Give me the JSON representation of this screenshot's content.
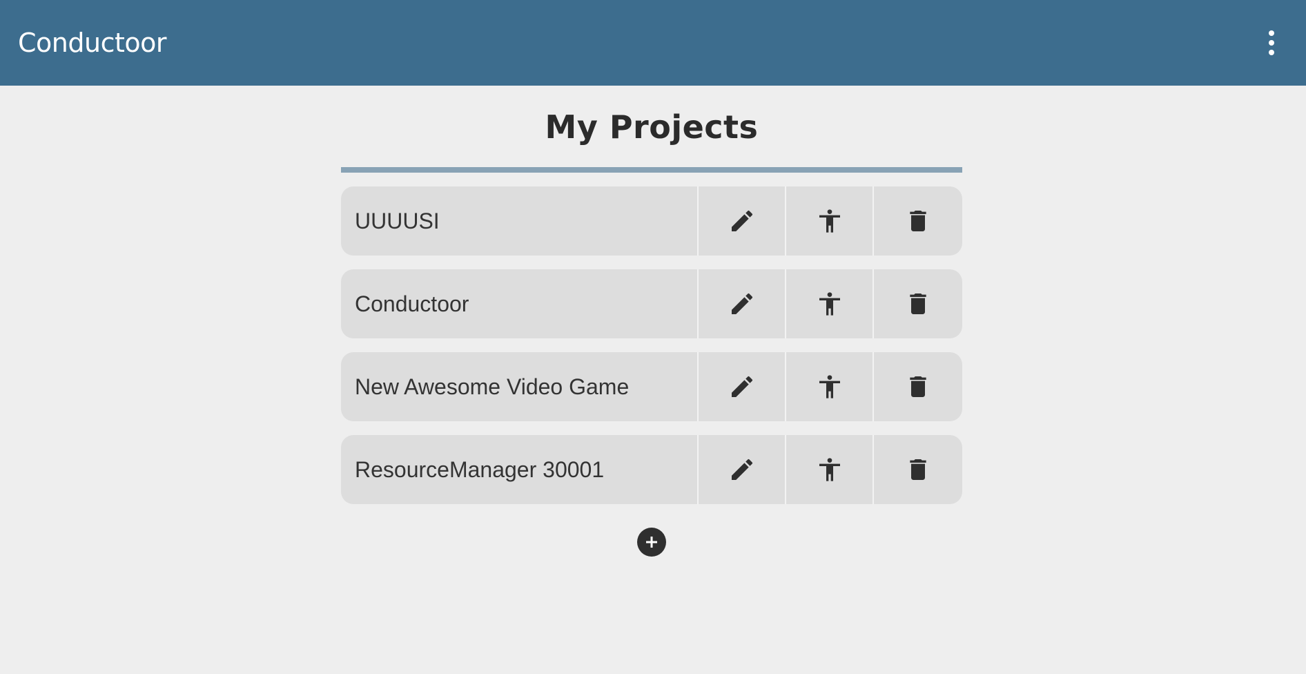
{
  "app": {
    "title": "Conductoor",
    "menu_icon": "more-vert-icon"
  },
  "page": {
    "title": "My Projects"
  },
  "projects": [
    {
      "name": "UUUUSI"
    },
    {
      "name": "Conductoor"
    },
    {
      "name": "New Awesome Video Game"
    },
    {
      "name": "ResourceManager 30001"
    }
  ],
  "row_actions": [
    "edit-icon",
    "accessibility-icon",
    "delete-icon"
  ],
  "add_button": {
    "icon": "add-circle-icon"
  },
  "colors": {
    "app_bar": "#3d6d8e",
    "background": "#eeeeee",
    "row_background": "#dddddd",
    "title_rule": "#88a2b5",
    "icon": "#2f2f2f"
  }
}
